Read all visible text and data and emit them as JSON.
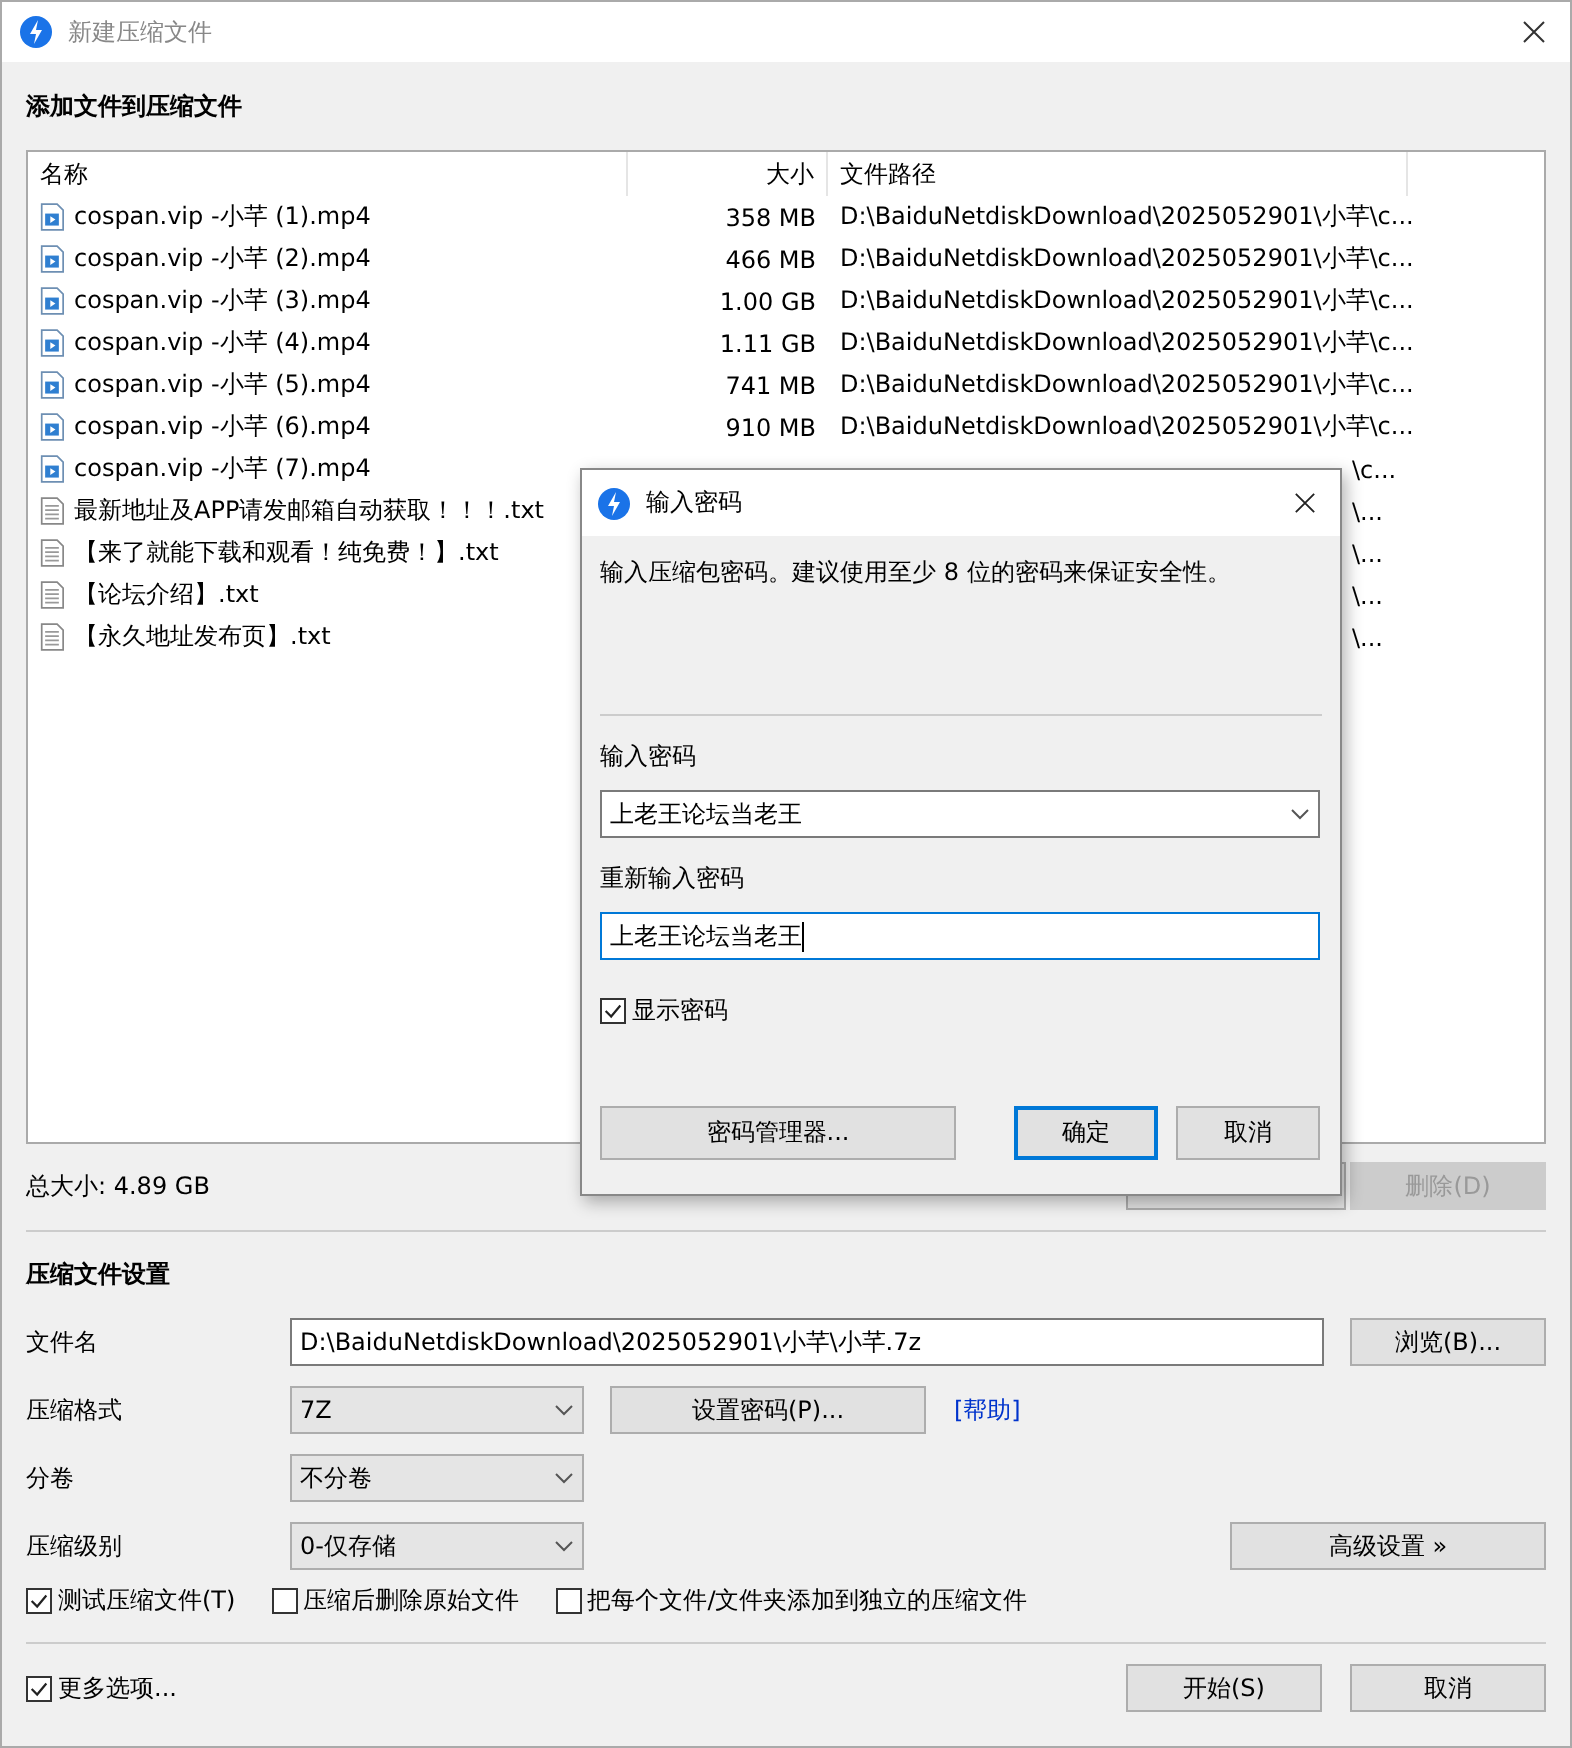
{
  "window": {
    "title": "新建压缩文件"
  },
  "files_section": {
    "title": "添加文件到压缩文件",
    "columns": [
      "名称",
      "大小",
      "文件路径"
    ],
    "rows": [
      {
        "kind": "video",
        "name": "cospan.vip -小芊 (1).mp4",
        "size": "358 MB",
        "path": "D:\\BaiduNetdiskDownload\\2025052901\\小芊\\c..."
      },
      {
        "kind": "video",
        "name": "cospan.vip -小芊 (2).mp4",
        "size": "466 MB",
        "path": "D:\\BaiduNetdiskDownload\\2025052901\\小芊\\c..."
      },
      {
        "kind": "video",
        "name": "cospan.vip -小芊 (3).mp4",
        "size": "1.00 GB",
        "path": "D:\\BaiduNetdiskDownload\\2025052901\\小芊\\c..."
      },
      {
        "kind": "video",
        "name": "cospan.vip -小芊 (4).mp4",
        "size": "1.11 GB",
        "path": "D:\\BaiduNetdiskDownload\\2025052901\\小芊\\c..."
      },
      {
        "kind": "video",
        "name": "cospan.vip -小芊 (5).mp4",
        "size": "741 MB",
        "path": "D:\\BaiduNetdiskDownload\\2025052901\\小芊\\c..."
      },
      {
        "kind": "video",
        "name": "cospan.vip -小芊 (6).mp4",
        "size": "910 MB",
        "path": "D:\\BaiduNetdiskDownload\\2025052901\\小芊\\c..."
      },
      {
        "kind": "video",
        "name": "cospan.vip -小芊 (7).mp4",
        "path_tail": "\\c..."
      },
      {
        "kind": "text",
        "name": "最新地址及APP请发邮箱自动获取！！！.txt",
        "path_tail": "\\..."
      },
      {
        "kind": "text",
        "name": "【来了就能下载和观看！纯免费！】.txt",
        "path_tail": "\\..."
      },
      {
        "kind": "text",
        "name": "【论坛介绍】.txt",
        "path_tail": "\\..."
      },
      {
        "kind": "text",
        "name": "【永久地址发布页】.txt",
        "path_tail": "\\..."
      }
    ],
    "total": "总大小: 4.89 GB",
    "buttons": [
      {
        "disabled": false
      },
      {
        "label": "删除(D)",
        "disabled": true
      }
    ]
  },
  "settings": {
    "title": "压缩文件设置",
    "filename_label": "文件名",
    "filename": "D:\\BaiduNetdiskDownload\\2025052901\\小芊\\小芊.7z",
    "browse": "浏览(B)...",
    "format_label": "压缩格式",
    "format": "7Z",
    "set_password": "设置密码(P)...",
    "help": "[帮助]",
    "volume_label": "分卷",
    "volume": "不分卷",
    "level_label": "压缩级别",
    "level_value": "0-仅存储",
    "advanced": "高级设置 »",
    "options": [
      {
        "label": "测试压缩文件(T)",
        "checked": true
      },
      {
        "label": "压缩后删除原始文件",
        "checked": false
      },
      {
        "label": "把每个文件/文件夹添加到独立的压缩文件",
        "checked": false
      }
    ]
  },
  "footer": {
    "more": {
      "label": "更多选项...",
      "checked": true
    },
    "start": "开始(S)",
    "cancel": "取消"
  },
  "dialog": {
    "title": "输入密码",
    "message": "输入压缩包密码。建议使用至少 8 位的密码来保证安全性。",
    "password_label": "输入密码",
    "password": "上老王论坛当老王",
    "repeat_label": "重新输入密码",
    "repeat": "上老王论坛当老王",
    "show": {
      "label": "显示密码",
      "checked": true
    },
    "manager": "密码管理器...",
    "ok": "确定",
    "cancel": "取消"
  }
}
